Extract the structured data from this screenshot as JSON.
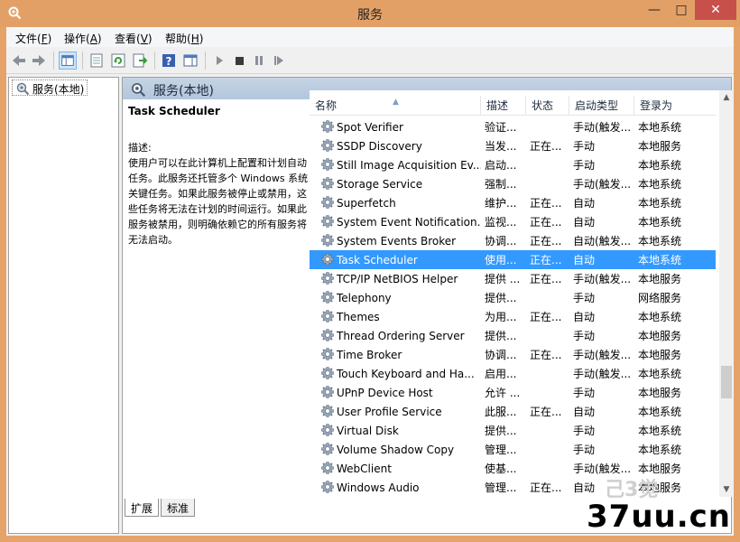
{
  "window": {
    "title": "服务",
    "minimize": "—",
    "maximize": "□",
    "close": "✕"
  },
  "menu": [
    {
      "label": "文件",
      "key": "F"
    },
    {
      "label": "操作",
      "key": "A"
    },
    {
      "label": "查看",
      "key": "V"
    },
    {
      "label": "帮助",
      "key": "H"
    }
  ],
  "tree": {
    "item": "服务(本地)"
  },
  "main": {
    "header": "服务(本地)",
    "selected_title": "Task Scheduler",
    "desc_label": "描述:",
    "desc_body": "使用户可以在此计算机上配置和计划自动任务。此服务还托管多个 Windows 系统关键任务。如果此服务被停止或禁用，这些任务将无法在计划的时间运行。如果此服务被禁用，则明确依赖它的所有服务将无法启动。"
  },
  "columns": {
    "name": "名称",
    "desc": "描述",
    "state": "状态",
    "start": "启动类型",
    "logon": "登录为"
  },
  "services": [
    {
      "name": "Spot Verifier",
      "desc": "验证...",
      "state": "",
      "start": "手动(触发...",
      "logon": "本地系统"
    },
    {
      "name": "SSDP Discovery",
      "desc": "当发...",
      "state": "正在...",
      "start": "手动",
      "logon": "本地服务"
    },
    {
      "name": "Still Image Acquisition Ev...",
      "desc": "启动...",
      "state": "",
      "start": "手动",
      "logon": "本地系统"
    },
    {
      "name": "Storage Service",
      "desc": "强制...",
      "state": "",
      "start": "手动(触发...",
      "logon": "本地系统"
    },
    {
      "name": "Superfetch",
      "desc": "维护...",
      "state": "正在...",
      "start": "自动",
      "logon": "本地系统"
    },
    {
      "name": "System Event Notification...",
      "desc": "监视...",
      "state": "正在...",
      "start": "自动",
      "logon": "本地系统"
    },
    {
      "name": "System Events Broker",
      "desc": "协调...",
      "state": "正在...",
      "start": "自动(触发...",
      "logon": "本地系统"
    },
    {
      "name": "Task Scheduler",
      "desc": "使用...",
      "state": "正在...",
      "start": "自动",
      "logon": "本地系统"
    },
    {
      "name": "TCP/IP NetBIOS Helper",
      "desc": "提供 ...",
      "state": "正在...",
      "start": "手动(触发...",
      "logon": "本地服务"
    },
    {
      "name": "Telephony",
      "desc": "提供...",
      "state": "",
      "start": "手动",
      "logon": "网络服务"
    },
    {
      "name": "Themes",
      "desc": "为用...",
      "state": "正在...",
      "start": "自动",
      "logon": "本地系统"
    },
    {
      "name": "Thread Ordering Server",
      "desc": "提供...",
      "state": "",
      "start": "手动",
      "logon": "本地服务"
    },
    {
      "name": "Time Broker",
      "desc": "协调...",
      "state": "正在...",
      "start": "手动(触发...",
      "logon": "本地服务"
    },
    {
      "name": "Touch Keyboard and Ha...",
      "desc": "启用...",
      "state": "",
      "start": "手动(触发...",
      "logon": "本地系统"
    },
    {
      "name": "UPnP Device Host",
      "desc": "允许 ...",
      "state": "",
      "start": "手动",
      "logon": "本地服务"
    },
    {
      "name": "User Profile Service",
      "desc": "此服...",
      "state": "正在...",
      "start": "自动",
      "logon": "本地系统"
    },
    {
      "name": "Virtual Disk",
      "desc": "提供...",
      "state": "",
      "start": "手动",
      "logon": "本地系统"
    },
    {
      "name": "Volume Shadow Copy",
      "desc": "管理...",
      "state": "",
      "start": "手动",
      "logon": "本地系统"
    },
    {
      "name": "WebClient",
      "desc": "使基...",
      "state": "",
      "start": "手动(触发...",
      "logon": "本地服务"
    },
    {
      "name": "Windows Audio",
      "desc": "管理...",
      "state": "正在...",
      "start": "自动",
      "logon": "本地服务"
    }
  ],
  "selected_index": 7,
  "tabs": {
    "extended": "扩展",
    "standard": "标准"
  },
  "watermark": {
    "text": "37uu.cn",
    "ghost": "己3觉"
  },
  "colors": {
    "title_bar": "#e3a066",
    "selection": "#3399ff",
    "close_button": "#c7504b",
    "header_gradient": "#c6d4e4"
  },
  "icons": {
    "app": "services-gear-magnifier-icon",
    "back": "back-arrow-icon",
    "forward": "forward-arrow-icon",
    "console_tree": "show-hide-console-tree-icon",
    "properties": "properties-icon",
    "refresh": "refresh-icon",
    "export": "export-list-icon",
    "help": "help-icon",
    "action_pane": "show-action-pane-icon",
    "start": "start-service-icon",
    "stop": "stop-service-icon",
    "pause": "pause-service-icon",
    "restart": "restart-service-icon",
    "service": "service-gear-icon"
  }
}
